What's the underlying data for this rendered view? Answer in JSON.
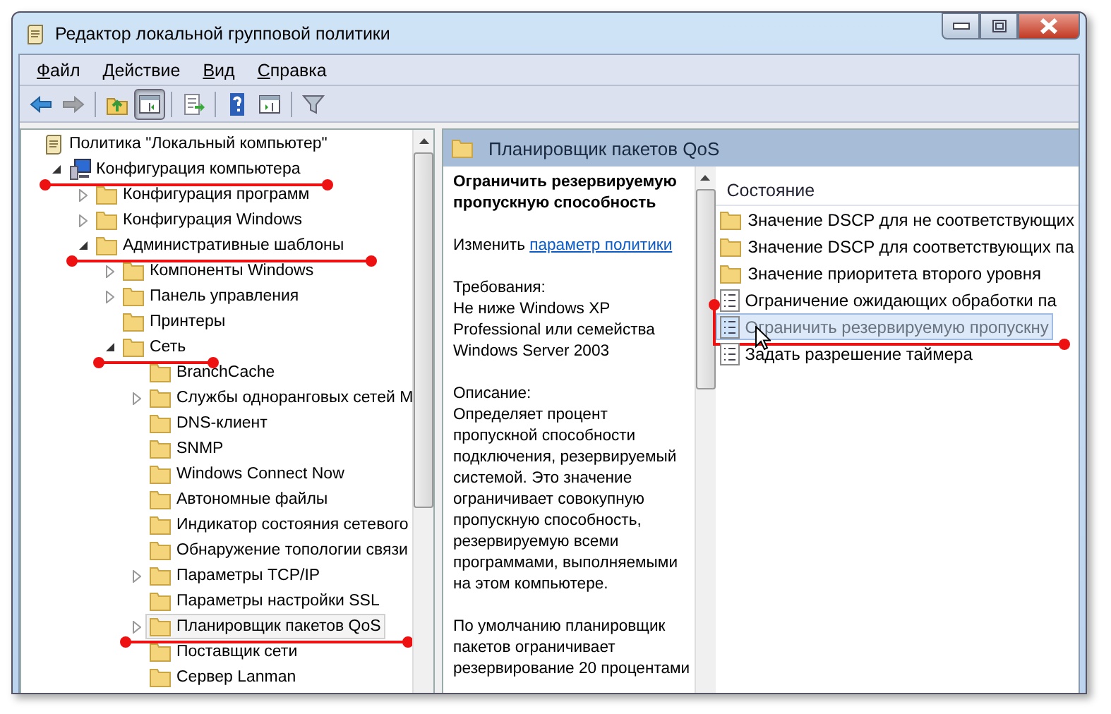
{
  "window": {
    "title": "Редактор локальной групповой политики"
  },
  "menu": [
    "Файл",
    "Действие",
    "Вид",
    "Справка"
  ],
  "toolbar": [
    {
      "kind": "back",
      "disabled": false,
      "pressed": false
    },
    {
      "kind": "forward",
      "disabled": true,
      "pressed": false
    },
    {
      "kind": "separator"
    },
    {
      "kind": "up",
      "disabled": false,
      "pressed": false
    },
    {
      "kind": "tree",
      "disabled": false,
      "pressed": true
    },
    {
      "kind": "separator"
    },
    {
      "kind": "export",
      "disabled": false,
      "pressed": false
    },
    {
      "kind": "separator"
    },
    {
      "kind": "help",
      "disabled": false,
      "pressed": false
    },
    {
      "kind": "action",
      "disabled": false,
      "pressed": false
    },
    {
      "kind": "separator"
    },
    {
      "kind": "filter",
      "disabled": false,
      "pressed": false
    }
  ],
  "tree": [
    {
      "label": "Политика \"Локальный компьютер\"",
      "kind": "policy",
      "selected": false,
      "marked": false,
      "children": [
        {
          "label": "Конфигурация компьютера",
          "kind": "computer",
          "expanded": true,
          "selected": false,
          "marked": true,
          "children": [
            {
              "label": "Конфигурация программ",
              "kind": "folder",
              "expanded": false,
              "selected": false,
              "marked": false
            },
            {
              "label": "Конфигурация Windows",
              "kind": "folder",
              "expanded": false,
              "selected": false,
              "marked": false
            },
            {
              "label": "Административные шаблоны",
              "kind": "folder",
              "expanded": true,
              "selected": false,
              "marked": true,
              "children": [
                {
                  "label": "Компоненты Windows",
                  "kind": "folder",
                  "expanded": false,
                  "selected": false,
                  "marked": false
                },
                {
                  "label": "Панель управления",
                  "kind": "folder",
                  "expanded": false,
                  "selected": false,
                  "marked": false
                },
                {
                  "label": "Принтеры",
                  "kind": "folder",
                  "selected": false,
                  "marked": false
                },
                {
                  "label": "Сеть",
                  "kind": "folder",
                  "expanded": true,
                  "selected": false,
                  "marked": true,
                  "children": [
                    {
                      "label": "BranchCache",
                      "kind": "folder",
                      "selected": false,
                      "marked": false
                    },
                    {
                      "label": "Службы одноранговых сетей М",
                      "kind": "folder",
                      "expanded": false,
                      "selected": false,
                      "marked": false
                    },
                    {
                      "label": "DNS-клиент",
                      "kind": "folder",
                      "selected": false,
                      "marked": false
                    },
                    {
                      "label": "SNMP",
                      "kind": "folder",
                      "selected": false,
                      "marked": false
                    },
                    {
                      "label": "Windows Connect Now",
                      "kind": "folder",
                      "selected": false,
                      "marked": false
                    },
                    {
                      "label": "Автономные файлы",
                      "kind": "folder",
                      "selected": false,
                      "marked": false
                    },
                    {
                      "label": "Индикатор состояния сетевого",
                      "kind": "folder",
                      "selected": false,
                      "marked": false
                    },
                    {
                      "label": "Обнаружение топологии связи",
                      "kind": "folder",
                      "selected": false,
                      "marked": false
                    },
                    {
                      "label": "Параметры TCP/IP",
                      "kind": "folder",
                      "expanded": false,
                      "selected": false,
                      "marked": false
                    },
                    {
                      "label": "Параметры настройки SSL",
                      "kind": "folder",
                      "selected": false,
                      "marked": false
                    },
                    {
                      "label": "Планировщик пакетов QoS",
                      "kind": "folder",
                      "expanded": false,
                      "selected": true,
                      "marked": true
                    },
                    {
                      "label": "Поставщик сети",
                      "kind": "folder",
                      "selected": false,
                      "marked": false
                    },
                    {
                      "label": "Сервер Lanman",
                      "kind": "folder",
                      "selected": false,
                      "marked": false
                    }
                  ]
                }
              ]
            }
          ]
        }
      ]
    }
  ],
  "details": {
    "header": "Планировщик пакетов QoS",
    "title": "Ограничить резервируемую пропускную способность",
    "edit_prefix": "Изменить",
    "edit_link": "параметр политики",
    "requirements_label": "Требования:",
    "requirements": "Не ниже Windows XP Professional или семейства Windows Server 2003",
    "description_label": "Описание:",
    "description": "Определяет процент пропускной способности подключения, резервируемый системой. Это значение ограничивает совокупную пропускную способность, резервируемую всеми программами, выполняемыми на этом компьютере.",
    "default_note": "По умолчанию планировщик пакетов ограничивает резервирование 20 процентами"
  },
  "list": {
    "column": "Состояние",
    "items": [
      {
        "label": "Значение DSCP для не соответствующих",
        "kind": "folder",
        "selected": false,
        "marked": false
      },
      {
        "label": "Значение DSCP для соответствующих па",
        "kind": "folder",
        "selected": false,
        "marked": false
      },
      {
        "label": "Значение приоритета второго уровня",
        "kind": "folder",
        "selected": false,
        "marked": false
      },
      {
        "label": "Ограничение ожидающих обработки па",
        "kind": "setting",
        "selected": false,
        "marked": false
      },
      {
        "label": "Ограничить резервируемую пропускну",
        "kind": "setting",
        "selected": true,
        "marked": true
      },
      {
        "label": "Задать разрешение таймера",
        "kind": "setting",
        "selected": false,
        "marked": false
      }
    ]
  }
}
